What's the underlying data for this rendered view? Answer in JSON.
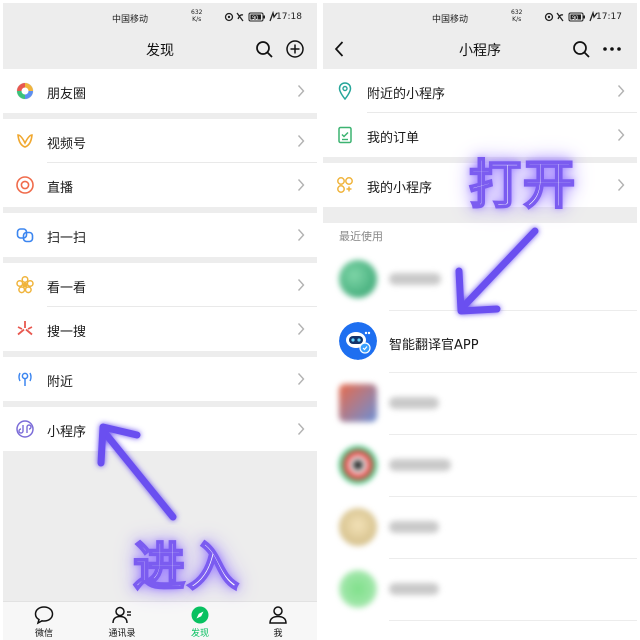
{
  "status_bar": {
    "carrier": "中国移动",
    "speed_value": "632",
    "speed_unit": "K/s",
    "battery": "90",
    "time_left": "17:18",
    "time_right": "17:17"
  },
  "left": {
    "title": "发现",
    "menu": [
      {
        "label": "朋友圈",
        "icon": "moments-icon"
      },
      {
        "label": "视频号",
        "icon": "channels-icon"
      },
      {
        "label": "直播",
        "icon": "live-icon"
      },
      {
        "label": "扫一扫",
        "icon": "scan-icon"
      },
      {
        "label": "看一看",
        "icon": "top-stories-icon"
      },
      {
        "label": "搜一搜",
        "icon": "search-icon"
      },
      {
        "label": "附近",
        "icon": "nearby-icon"
      },
      {
        "label": "小程序",
        "icon": "mini-program-icon"
      }
    ],
    "tabs": [
      {
        "label": "微信"
      },
      {
        "label": "通讯录"
      },
      {
        "label": "发现",
        "active": true
      },
      {
        "label": "我"
      }
    ],
    "overlay": "进入"
  },
  "right": {
    "title": "小程序",
    "menu": [
      {
        "label": "附近的小程序",
        "icon": "location-pin-icon"
      },
      {
        "label": "我的订单",
        "icon": "order-icon"
      },
      {
        "label": "我的小程序",
        "icon": "my-mini-program-icon"
      }
    ],
    "section_label": "最近使用",
    "highlighted_app": "智能翻译官APP",
    "overlay": "打开"
  },
  "colors": {
    "wechat_green": "#07c160",
    "overlay_purple": "#7b5cf0"
  }
}
